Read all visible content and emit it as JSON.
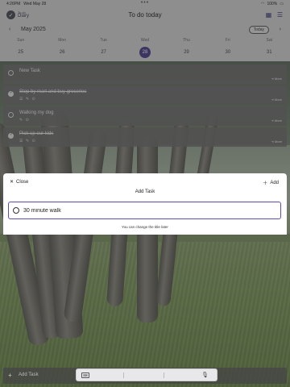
{
  "status_bar": {
    "time": "4:26PM",
    "date": "Wed May 28",
    "dots": "•••",
    "battery": "100%"
  },
  "app": {
    "small_label": "To do",
    "name": "Diary",
    "page_title": "To do today"
  },
  "calendar": {
    "month": "May 2025",
    "today_label": "Today",
    "days": [
      {
        "dow": "Sun",
        "date": "25"
      },
      {
        "dow": "Mon",
        "date": "26"
      },
      {
        "dow": "Tue",
        "date": "27"
      },
      {
        "dow": "Wed",
        "date": "28"
      },
      {
        "dow": "Thu",
        "date": "29"
      },
      {
        "dow": "Fri",
        "date": "30"
      },
      {
        "dow": "Sat",
        "date": "31"
      }
    ],
    "selected_index": 3
  },
  "tasks": [
    {
      "title": "New Task",
      "done": false,
      "meta": "",
      "more": "⇥ More"
    },
    {
      "title": "Stop by mart and buy groceries",
      "done": true,
      "meta": "☰ ✎ ⊙",
      "more": "⇥ More"
    },
    {
      "title": "Walking my dog",
      "done": false,
      "meta": "✎ ⊙",
      "more": "⇥ More"
    },
    {
      "title": "Pick up our kids",
      "done": true,
      "meta": "☰ ✎ ⊙",
      "more": "⇥ More"
    }
  ],
  "modal": {
    "close_label": "Close",
    "add_label": "Add",
    "title": "Add Task",
    "input_value": "30 minute walk",
    "hint": "You can change the title later"
  },
  "bottom_bar": {
    "add_task_label": "Add Task"
  },
  "colors": {
    "accent": "#4d3e8a",
    "input_border": "#5a4db0"
  }
}
